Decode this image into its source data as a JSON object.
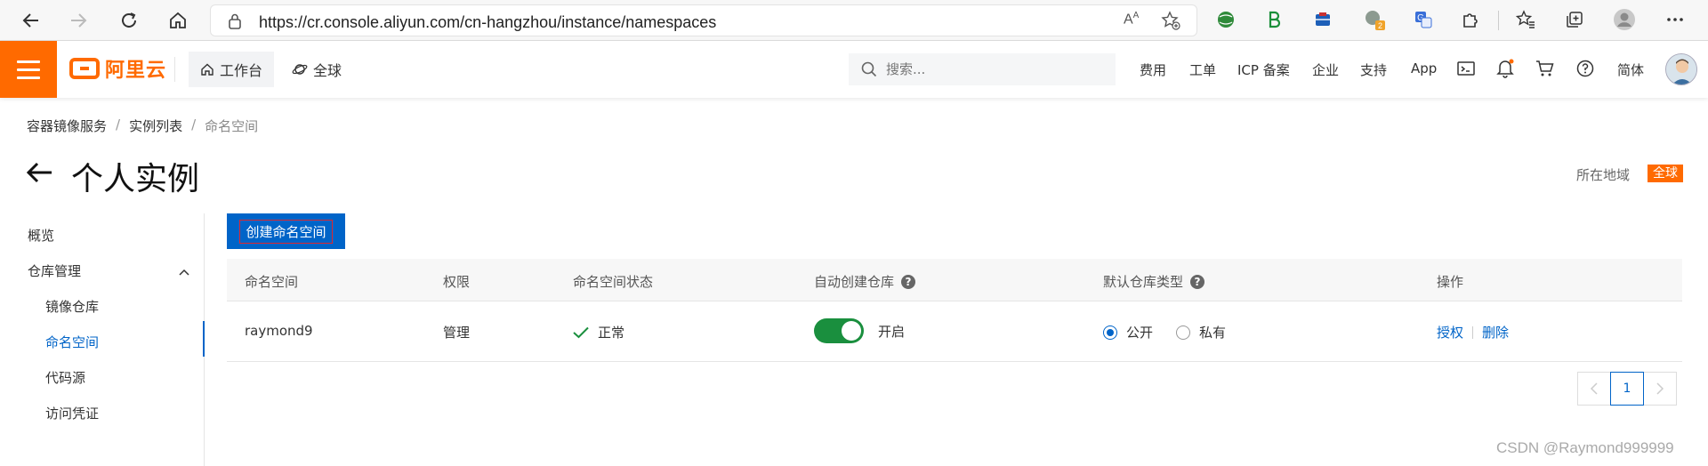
{
  "browser": {
    "url": "https://cr.console.aliyun.com/cn-hangzhou/instance/namespaces",
    "read_aloud_icon": "read-aloud-icon",
    "ext_badge": "2"
  },
  "header": {
    "logo_text": "阿里云",
    "workbench": "工作台",
    "global": "全球",
    "search_placeholder": "搜索...",
    "nav": [
      "费用",
      "工单",
      "ICP 备案",
      "企业",
      "支持",
      "App"
    ],
    "language": "简体",
    "accent_color": "#ff6a00"
  },
  "breadcrumb": {
    "items": [
      "容器镜像服务",
      "实例列表",
      "命名空间"
    ],
    "separator": "/"
  },
  "page": {
    "title": "个人实例",
    "region_label": "所在地域",
    "region_value": "全球"
  },
  "sidebar": {
    "overview": "概览",
    "repo_manage": "仓库管理",
    "items": [
      "镜像仓库",
      "命名空间",
      "代码源",
      "访问凭证"
    ],
    "active": "命名空间"
  },
  "main": {
    "create_button": "创建命名空间",
    "columns": [
      "命名空间",
      "权限",
      "命名空间状态",
      "自动创建仓库",
      "默认仓库类型",
      "操作"
    ],
    "rows": [
      {
        "namespace": "raymond9",
        "permission": "管理",
        "status": "正常",
        "auto_create": "开启",
        "auto_create_on": true,
        "repo_type_public": "公开",
        "repo_type_private": "私有",
        "repo_type_selected": "公开",
        "op_authorize": "授权",
        "op_delete": "删除"
      }
    ],
    "pagination": {
      "current": "1"
    },
    "primary_color": "#0064c8"
  },
  "watermark": "CSDN @Raymond999999"
}
